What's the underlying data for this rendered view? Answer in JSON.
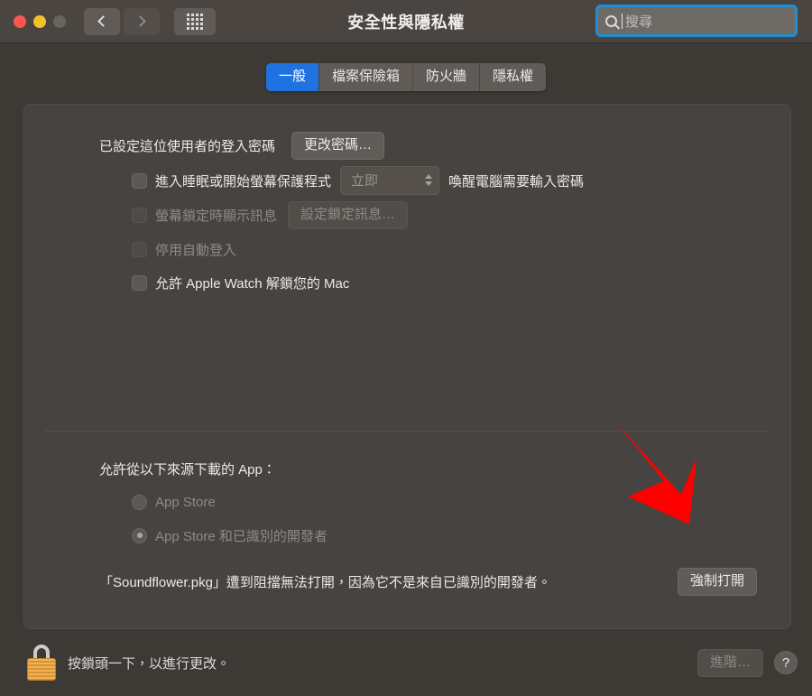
{
  "titlebar": {
    "title": "安全性與隱私權",
    "traffic_lights": [
      {
        "name": "close",
        "color": "#f9574f"
      },
      {
        "name": "minimize",
        "color": "#f2c12d"
      },
      {
        "name": "zoom",
        "color": "#686460"
      }
    ],
    "back_icon": "chevron-left-icon",
    "forward_icon": "chevron-right-icon",
    "grid_icon": "grid-view-icon",
    "search": {
      "placeholder": "搜尋",
      "value": "",
      "icon": "search-icon",
      "focus_ring_color": "#1e8fd4"
    }
  },
  "tabs": [
    {
      "label": "一般",
      "active": true
    },
    {
      "label": "檔案保險箱",
      "active": false
    },
    {
      "label": "防火牆",
      "active": false
    },
    {
      "label": "隱私權",
      "active": false
    }
  ],
  "general": {
    "password_status": "已設定這位使用者的登入密碼",
    "change_password_button": "更改密碼…",
    "options": [
      {
        "label": "進入睡眠或開始螢幕保護程式",
        "checked": false,
        "disabled": false,
        "popup_value": "立即",
        "suffix_label": "喚醒電腦需要輸入密碼"
      },
      {
        "label": "螢幕鎖定時顯示訊息",
        "checked": false,
        "disabled": true,
        "button_label": "設定鎖定訊息…"
      },
      {
        "label": "停用自動登入",
        "checked": false,
        "disabled": true
      },
      {
        "label": "允許 Apple Watch 解鎖您的 Mac",
        "checked": false,
        "disabled": false
      }
    ]
  },
  "download_sources": {
    "heading": "允許從以下來源下載的 App：",
    "options": [
      {
        "label": "App Store",
        "selected": false,
        "disabled": true
      },
      {
        "label": "App Store 和已識別的開發者",
        "selected": true,
        "disabled": true
      }
    ],
    "blocked_message": "「Soundflower.pkg」遭到阻擋無法打開，因為它不是來自已識別的開發者。",
    "open_anyway_button": "強制打開"
  },
  "annotation": {
    "arrow_color": "#fe0000",
    "arrow_target": "強制打開"
  },
  "footer": {
    "lock_icon": "padlock-closed-icon",
    "message": "按鎖頭一下，以進行更改。",
    "advanced_button": "進階…",
    "help_button": "?"
  }
}
